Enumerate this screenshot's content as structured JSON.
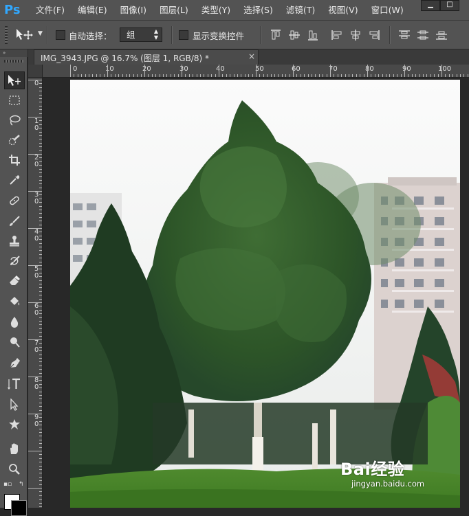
{
  "app": {
    "logo": "Ps",
    "accent": "#31a8ff"
  },
  "menu": {
    "items": [
      "文件(F)",
      "编辑(E)",
      "图像(I)",
      "图层(L)",
      "类型(Y)",
      "选择(S)",
      "滤镜(T)",
      "视图(V)",
      "窗口(W)"
    ],
    "window_controls": [
      "minimize-icon",
      "maximize-icon"
    ]
  },
  "options_bar": {
    "tool_icon": "move-tool-icon",
    "auto_select_label": "自动选择：",
    "auto_select_checked": false,
    "auto_select_value": "组",
    "transform_controls_label": "显示变换控件",
    "transform_controls_checked": false,
    "align_icons": [
      "align-top-edges-icon",
      "align-vertical-centers-icon",
      "align-bottom-edges-icon",
      "align-left-edges-icon",
      "align-horizontal-centers-icon",
      "align-right-edges-icon",
      "distribute-top-icon",
      "distribute-vertical-centers-icon",
      "distribute-bottom-icon"
    ]
  },
  "toolbox": {
    "header": "»",
    "tools": [
      "move-tool-icon",
      "marquee-tool-icon",
      "lasso-tool-icon",
      "quick-selection-tool-icon",
      "crop-tool-icon",
      "eyedropper-tool-icon",
      "healing-brush-tool-icon",
      "brush-tool-icon",
      "clone-stamp-tool-icon",
      "history-brush-tool-icon",
      "eraser-tool-icon",
      "paint-bucket-tool-icon",
      "blur-tool-icon",
      "dodge-tool-icon",
      "pen-tool-icon",
      "type-tool-icon",
      "path-selection-tool-icon",
      "custom-shape-tool-icon",
      "hand-tool-icon",
      "zoom-tool-icon"
    ],
    "active_tool": "move-tool-icon",
    "foreground_color": "#ffffff",
    "background_color": "#000000"
  },
  "document": {
    "tab_title": "IMG_3943.JPG @ 16.7% (图层 1, RGB/8) *",
    "close_label": "×"
  },
  "rulers": {
    "horizontal": [
      "0",
      "10",
      "20",
      "30",
      "40",
      "50",
      "60",
      "70",
      "80",
      "90",
      "100"
    ],
    "vertical": [
      "0",
      "1 0",
      "2 0",
      "3 0",
      "4 0",
      "5 0",
      "6 0",
      "7 0",
      "8 0",
      "9 0"
    ]
  },
  "watermark": {
    "brand": "Bai经验",
    "url": "jingyan.baidu.com"
  }
}
